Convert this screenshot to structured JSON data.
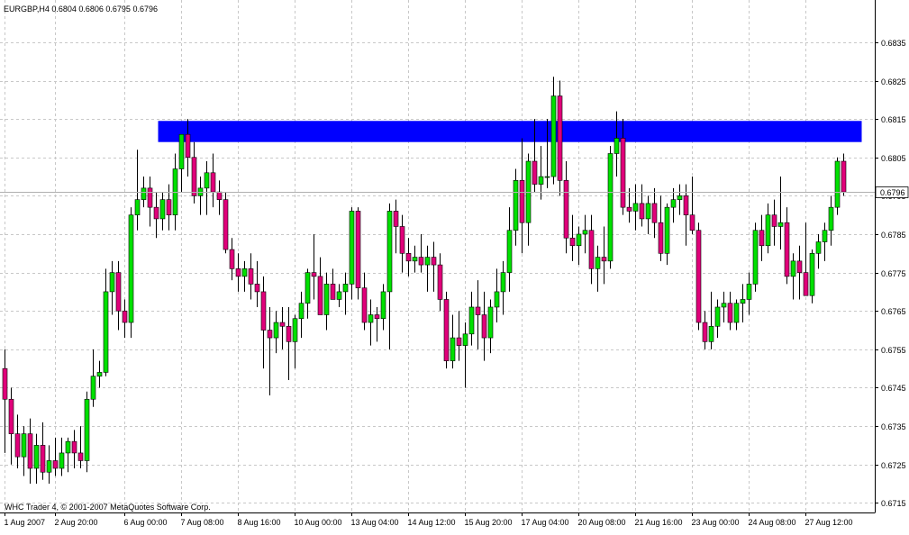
{
  "chart_title": "EURGBP,H4  0.6804 0.6806 0.6795 0.6796",
  "copyright": "WHC Trader 4, © 2001-2007 MetaQuotes Software Corp.",
  "colors": {
    "bull": "#00e000",
    "bear": "#e0007a",
    "zone": "#0000ff",
    "grid": "#c8c8c8",
    "text": "#000000"
  },
  "chart_data": {
    "type": "candlestick",
    "symbol": "EURGBP",
    "timeframe": "H4",
    "last_price": 0.6796,
    "last_price_label": "0.6796",
    "ylim": [
      0.67125,
      0.6846
    ],
    "y_ticks": [
      0.6715,
      0.6725,
      0.6735,
      0.6745,
      0.6755,
      0.6765,
      0.6775,
      0.6785,
      0.6795,
      0.6805,
      0.6815,
      0.6825,
      0.6835
    ],
    "y_tick_labels": [
      "0.6715",
      "0.6725",
      "0.6735",
      "0.6745",
      "0.6755",
      "0.6765",
      "0.6775",
      "0.6785",
      "0.6795",
      "0.6805",
      "0.6815",
      "0.6825",
      "0.6835"
    ],
    "x_tick_labels": [
      {
        "bar": 0,
        "label": "1 Aug 2007"
      },
      {
        "bar": 8,
        "label": "2 Aug 20:00"
      },
      {
        "bar": 19,
        "label": "6 Aug 00:00"
      },
      {
        "bar": 28,
        "label": "7 Aug 08:00"
      },
      {
        "bar": 37,
        "label": "8 Aug 16:00"
      },
      {
        "bar": 46,
        "label": "10 Aug 00:00"
      },
      {
        "bar": 55,
        "label": "13 Aug 04:00"
      },
      {
        "bar": 64,
        "label": "14 Aug 12:00"
      },
      {
        "bar": 73,
        "label": "15 Aug 20:00"
      },
      {
        "bar": 82,
        "label": "17 Aug 04:00"
      },
      {
        "bar": 91,
        "label": "20 Aug 08:00"
      },
      {
        "bar": 100,
        "label": "21 Aug 16:00"
      },
      {
        "bar": 109,
        "label": "23 Aug 00:00"
      },
      {
        "bar": 118,
        "label": "24 Aug 08:00"
      },
      {
        "bar": 127,
        "label": "27 Aug 12:00"
      }
    ],
    "zone": {
      "bar_start": 25,
      "bar_end": 136,
      "y_low": 0.6809,
      "y_high": 0.68145
    },
    "ohlc": [
      [
        0.675,
        0.6755,
        0.6728,
        0.6742
      ],
      [
        0.6742,
        0.6745,
        0.6725,
        0.6733
      ],
      [
        0.6733,
        0.6738,
        0.6724,
        0.6727
      ],
      [
        0.6727,
        0.6735,
        0.6722,
        0.6733
      ],
      [
        0.6733,
        0.6737,
        0.672,
        0.6724
      ],
      [
        0.6724,
        0.6733,
        0.672,
        0.673
      ],
      [
        0.673,
        0.6736,
        0.6721,
        0.6723
      ],
      [
        0.6723,
        0.673,
        0.672,
        0.6726
      ],
      [
        0.6726,
        0.6732,
        0.6722,
        0.6724
      ],
      [
        0.6724,
        0.6732,
        0.6722,
        0.6728
      ],
      [
        0.6728,
        0.6732,
        0.6723,
        0.6731
      ],
      [
        0.6731,
        0.6734,
        0.6724,
        0.6728
      ],
      [
        0.6728,
        0.6735,
        0.6724,
        0.6726
      ],
      [
        0.6726,
        0.6744,
        0.6723,
        0.6742
      ],
      [
        0.6742,
        0.6755,
        0.674,
        0.6748
      ],
      [
        0.6748,
        0.6752,
        0.6745,
        0.6749
      ],
      [
        0.6749,
        0.6776,
        0.6748,
        0.677
      ],
      [
        0.677,
        0.6778,
        0.6764,
        0.6775
      ],
      [
        0.6775,
        0.6778,
        0.676,
        0.6765
      ],
      [
        0.6765,
        0.6768,
        0.6758,
        0.6762
      ],
      [
        0.6762,
        0.6792,
        0.6758,
        0.679
      ],
      [
        0.679,
        0.6807,
        0.6786,
        0.6794
      ],
      [
        0.6794,
        0.68,
        0.6792,
        0.6797
      ],
      [
        0.6797,
        0.68,
        0.6787,
        0.6792
      ],
      [
        0.6792,
        0.6796,
        0.6784,
        0.6789
      ],
      [
        0.6789,
        0.6796,
        0.6786,
        0.6794
      ],
      [
        0.6794,
        0.6798,
        0.6786,
        0.679
      ],
      [
        0.679,
        0.6806,
        0.6786,
        0.6802
      ],
      [
        0.6802,
        0.681,
        0.6796,
        0.6811
      ],
      [
        0.6811,
        0.6815,
        0.68,
        0.6805
      ],
      [
        0.6805,
        0.6809,
        0.6793,
        0.6795
      ],
      [
        0.6795,
        0.68,
        0.679,
        0.6797
      ],
      [
        0.6797,
        0.6804,
        0.679,
        0.6801
      ],
      [
        0.6801,
        0.6806,
        0.6792,
        0.6796
      ],
      [
        0.6796,
        0.6799,
        0.679,
        0.6794
      ],
      [
        0.6794,
        0.6796,
        0.678,
        0.6781
      ],
      [
        0.6781,
        0.6784,
        0.6773,
        0.6776
      ],
      [
        0.6776,
        0.678,
        0.677,
        0.6774
      ],
      [
        0.6774,
        0.6778,
        0.677,
        0.6776
      ],
      [
        0.6776,
        0.678,
        0.6768,
        0.6772
      ],
      [
        0.6772,
        0.6778,
        0.6766,
        0.677
      ],
      [
        0.677,
        0.6774,
        0.675,
        0.676
      ],
      [
        0.676,
        0.6766,
        0.6743,
        0.6758
      ],
      [
        0.6758,
        0.6765,
        0.6754,
        0.6762
      ],
      [
        0.6762,
        0.6766,
        0.6755,
        0.6761
      ],
      [
        0.6761,
        0.6766,
        0.6747,
        0.6757
      ],
      [
        0.6757,
        0.6764,
        0.675,
        0.6763
      ],
      [
        0.6763,
        0.677,
        0.6758,
        0.6767
      ],
      [
        0.6767,
        0.6776,
        0.6763,
        0.6775
      ],
      [
        0.6775,
        0.6785,
        0.6768,
        0.6774
      ],
      [
        0.6774,
        0.6779,
        0.6766,
        0.6764
      ],
      [
        0.6764,
        0.6775,
        0.676,
        0.6772
      ],
      [
        0.6772,
        0.6776,
        0.6768,
        0.6768
      ],
      [
        0.6768,
        0.6772,
        0.6766,
        0.677
      ],
      [
        0.677,
        0.6775,
        0.6764,
        0.6772
      ],
      [
        0.6772,
        0.6792,
        0.6768,
        0.6791
      ],
      [
        0.6791,
        0.6792,
        0.6768,
        0.6771
      ],
      [
        0.6771,
        0.6775,
        0.676,
        0.6762
      ],
      [
        0.6762,
        0.6768,
        0.6756,
        0.6764
      ],
      [
        0.6764,
        0.6766,
        0.6757,
        0.6763
      ],
      [
        0.6763,
        0.6772,
        0.676,
        0.677
      ],
      [
        0.677,
        0.6793,
        0.6755,
        0.6791
      ],
      [
        0.6791,
        0.6794,
        0.678,
        0.6787
      ],
      [
        0.6787,
        0.679,
        0.6775,
        0.678
      ],
      [
        0.678,
        0.6784,
        0.6774,
        0.6778
      ],
      [
        0.6778,
        0.6782,
        0.6775,
        0.6779
      ],
      [
        0.6779,
        0.6785,
        0.6775,
        0.6777
      ],
      [
        0.6777,
        0.6782,
        0.677,
        0.6779
      ],
      [
        0.6779,
        0.6783,
        0.677,
        0.6777
      ],
      [
        0.6777,
        0.678,
        0.6765,
        0.6768
      ],
      [
        0.6768,
        0.677,
        0.675,
        0.6752
      ],
      [
        0.6752,
        0.6764,
        0.675,
        0.6758
      ],
      [
        0.6758,
        0.6765,
        0.6752,
        0.6756
      ],
      [
        0.6756,
        0.6762,
        0.6745,
        0.6759
      ],
      [
        0.6759,
        0.677,
        0.6756,
        0.6766
      ],
      [
        0.6766,
        0.6773,
        0.6755,
        0.6764
      ],
      [
        0.6764,
        0.677,
        0.6752,
        0.6758
      ],
      [
        0.6758,
        0.6768,
        0.6754,
        0.6766
      ],
      [
        0.6766,
        0.6776,
        0.6762,
        0.677
      ],
      [
        0.677,
        0.6778,
        0.6764,
        0.6775
      ],
      [
        0.6775,
        0.6792,
        0.677,
        0.6786
      ],
      [
        0.6786,
        0.6802,
        0.6782,
        0.6799
      ],
      [
        0.6799,
        0.681,
        0.678,
        0.6788
      ],
      [
        0.6788,
        0.6806,
        0.6782,
        0.6804
      ],
      [
        0.6804,
        0.6815,
        0.6796,
        0.6798
      ],
      [
        0.6798,
        0.6808,
        0.6794,
        0.68
      ],
      [
        0.68,
        0.6815,
        0.6797,
        0.68
      ],
      [
        0.68,
        0.6826,
        0.6798,
        0.6821
      ],
      [
        0.6821,
        0.6825,
        0.6795,
        0.6799
      ],
      [
        0.6799,
        0.6804,
        0.678,
        0.6784
      ],
      [
        0.6784,
        0.679,
        0.6778,
        0.6782
      ],
      [
        0.6782,
        0.6787,
        0.6777,
        0.6785
      ],
      [
        0.6785,
        0.679,
        0.678,
        0.6786
      ],
      [
        0.6786,
        0.679,
        0.6772,
        0.6776
      ],
      [
        0.6776,
        0.6782,
        0.677,
        0.6779
      ],
      [
        0.6779,
        0.6787,
        0.6772,
        0.6778
      ],
      [
        0.6778,
        0.6808,
        0.6776,
        0.6806
      ],
      [
        0.6806,
        0.6817,
        0.68,
        0.681
      ],
      [
        0.681,
        0.6815,
        0.679,
        0.6792
      ],
      [
        0.6792,
        0.6797,
        0.6788,
        0.6791
      ],
      [
        0.6791,
        0.6798,
        0.6786,
        0.6793
      ],
      [
        0.6793,
        0.6798,
        0.6787,
        0.6789
      ],
      [
        0.6789,
        0.6795,
        0.6785,
        0.6793
      ],
      [
        0.6793,
        0.6797,
        0.6784,
        0.6788
      ],
      [
        0.6788,
        0.6795,
        0.6778,
        0.678
      ],
      [
        0.678,
        0.6793,
        0.6777,
        0.6792
      ],
      [
        0.6792,
        0.6797,
        0.6788,
        0.6794
      ],
      [
        0.6794,
        0.6798,
        0.679,
        0.6795
      ],
      [
        0.6795,
        0.6798,
        0.6782,
        0.679
      ],
      [
        0.679,
        0.68,
        0.6785,
        0.6786
      ],
      [
        0.6786,
        0.6788,
        0.676,
        0.6762
      ],
      [
        0.6762,
        0.6765,
        0.6755,
        0.6757
      ],
      [
        0.6757,
        0.677,
        0.6755,
        0.6761
      ],
      [
        0.6761,
        0.6768,
        0.6758,
        0.6766
      ],
      [
        0.6766,
        0.677,
        0.6762,
        0.6767
      ],
      [
        0.6767,
        0.677,
        0.676,
        0.6762
      ],
      [
        0.6762,
        0.6768,
        0.676,
        0.6767
      ],
      [
        0.6767,
        0.6772,
        0.6762,
        0.6768
      ],
      [
        0.6768,
        0.6775,
        0.6764,
        0.6772
      ],
      [
        0.6772,
        0.6788,
        0.677,
        0.6786
      ],
      [
        0.6786,
        0.679,
        0.6778,
        0.6782
      ],
      [
        0.6782,
        0.6793,
        0.678,
        0.679
      ],
      [
        0.679,
        0.6794,
        0.6782,
        0.6787
      ],
      [
        0.6787,
        0.68,
        0.6781,
        0.6788
      ],
      [
        0.6788,
        0.6792,
        0.6772,
        0.6774
      ],
      [
        0.6774,
        0.678,
        0.6768,
        0.6778
      ],
      [
        0.6778,
        0.6782,
        0.6768,
        0.6775
      ],
      [
        0.6775,
        0.6788,
        0.677,
        0.6769
      ],
      [
        0.6769,
        0.6781,
        0.6767,
        0.678
      ],
      [
        0.678,
        0.6785,
        0.6776,
        0.6783
      ],
      [
        0.6783,
        0.6788,
        0.6778,
        0.6786
      ],
      [
        0.6786,
        0.6795,
        0.6782,
        0.6792
      ],
      [
        0.6792,
        0.6805,
        0.679,
        0.6804
      ],
      [
        0.6804,
        0.6806,
        0.6795,
        0.6796
      ]
    ]
  }
}
